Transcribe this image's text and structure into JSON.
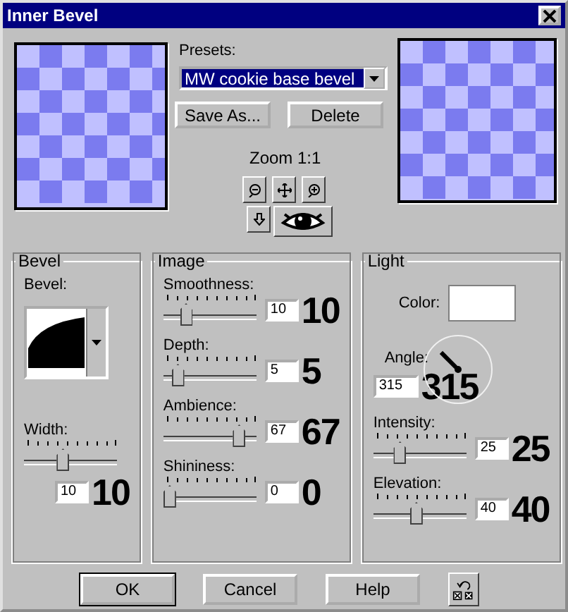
{
  "window": {
    "title": "Inner Bevel"
  },
  "presets": {
    "label": "Presets:",
    "value": "MW cookie base bevel"
  },
  "preset_buttons": [
    {
      "label": "Save As..."
    },
    {
      "label": "Delete"
    }
  ],
  "zoom": {
    "label": "Zoom 1:1"
  },
  "groups": [
    {
      "title": "Bevel",
      "controls": [
        {
          "kind": "profile",
          "label": "Bevel:"
        },
        {
          "kind": "stacked_slider",
          "label": "Width:",
          "level": 0.4,
          "value": "10",
          "annotation": "10"
        }
      ]
    },
    {
      "title": "Image",
      "controls": [
        {
          "kind": "slider",
          "label": "Smoothness:",
          "level": 0.2,
          "value": "10",
          "annotation": "10"
        },
        {
          "kind": "slider",
          "label": "Depth:",
          "level": 0.1,
          "value": "5",
          "annotation": "5"
        },
        {
          "kind": "slider",
          "label": "Ambience:",
          "level": 0.85,
          "value": "67",
          "annotation": "67"
        },
        {
          "kind": "slider",
          "label": "Shininess:",
          "level": 0,
          "value": "0",
          "annotation": "0"
        }
      ]
    },
    {
      "title": "Light",
      "controls": [
        {
          "kind": "color",
          "label": "Color:",
          "color": "#ffffff"
        },
        {
          "kind": "angle",
          "label": "Angle:",
          "value": "315",
          "annotation": "315"
        },
        {
          "kind": "slider",
          "label": "Intensity:",
          "level": 0.25,
          "value": "25",
          "annotation": "25"
        },
        {
          "kind": "slider",
          "label": "Elevation:",
          "level": 0.45,
          "value": "40",
          "annotation": "40"
        }
      ]
    }
  ],
  "buttons": [
    {
      "label": "OK",
      "default": true
    },
    {
      "label": "Cancel",
      "default": false
    },
    {
      "label": "Help",
      "default": false
    }
  ]
}
